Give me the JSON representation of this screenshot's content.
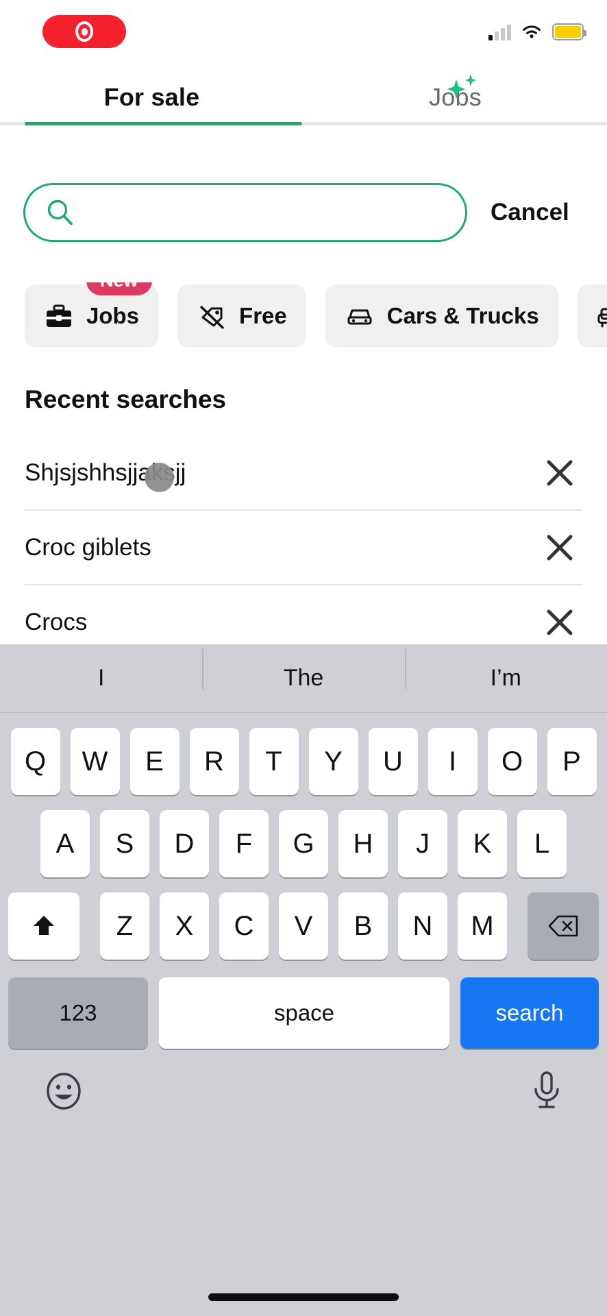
{
  "status_bar": {
    "recording_indicator": "record-pill",
    "signal_icon": "cellular-signal-icon",
    "signal_bars_active": 1,
    "signal_bars_total": 4,
    "wifi_icon": "wifi-icon",
    "battery_icon": "battery-icon",
    "battery_color": "#ffcc00"
  },
  "tabs": {
    "items": [
      {
        "label": "For sale",
        "active": true
      },
      {
        "label": "Jobs",
        "active": false,
        "badge_icon": "sparkle-icon"
      }
    ],
    "active_color": "#35a06a"
  },
  "search": {
    "value": "",
    "placeholder": "",
    "icon": "search-icon",
    "border_color": "#1faa72",
    "cancel_label": "Cancel"
  },
  "chips": [
    {
      "label": "Jobs",
      "icon": "briefcase-icon",
      "badge": "New"
    },
    {
      "label": "Free",
      "icon": "tag-slash-icon"
    },
    {
      "label": "Cars & Trucks",
      "icon": "car-icon"
    },
    {
      "label": "",
      "icon": "sofa-icon"
    }
  ],
  "recent_searches": {
    "title": "Recent searches",
    "items": [
      {
        "query": "Shjsjshhsjjaksjj",
        "remove_icon": "close-icon"
      },
      {
        "query": "Croc giblets",
        "remove_icon": "close-icon"
      },
      {
        "query": "Crocs",
        "remove_icon": "close-icon"
      }
    ]
  },
  "keyboard": {
    "suggestions": [
      "I",
      "The",
      "I’m"
    ],
    "row1": [
      "Q",
      "W",
      "E",
      "R",
      "T",
      "Y",
      "U",
      "I",
      "O",
      "P"
    ],
    "row2": [
      "A",
      "S",
      "D",
      "F",
      "G",
      "H",
      "J",
      "K",
      "L"
    ],
    "row3": [
      "Z",
      "X",
      "C",
      "V",
      "B",
      "N",
      "M"
    ],
    "shift_icon": "shift-icon",
    "backspace_icon": "backspace-icon",
    "numbers_label": "123",
    "space_label": "space",
    "return_label": "search",
    "return_color": "#1577f2",
    "emoji_icon": "emoji-icon",
    "mic_icon": "microphone-icon"
  },
  "touch_indicator": {
    "name": "tap-indicator",
    "color": "#8a8a8a"
  }
}
